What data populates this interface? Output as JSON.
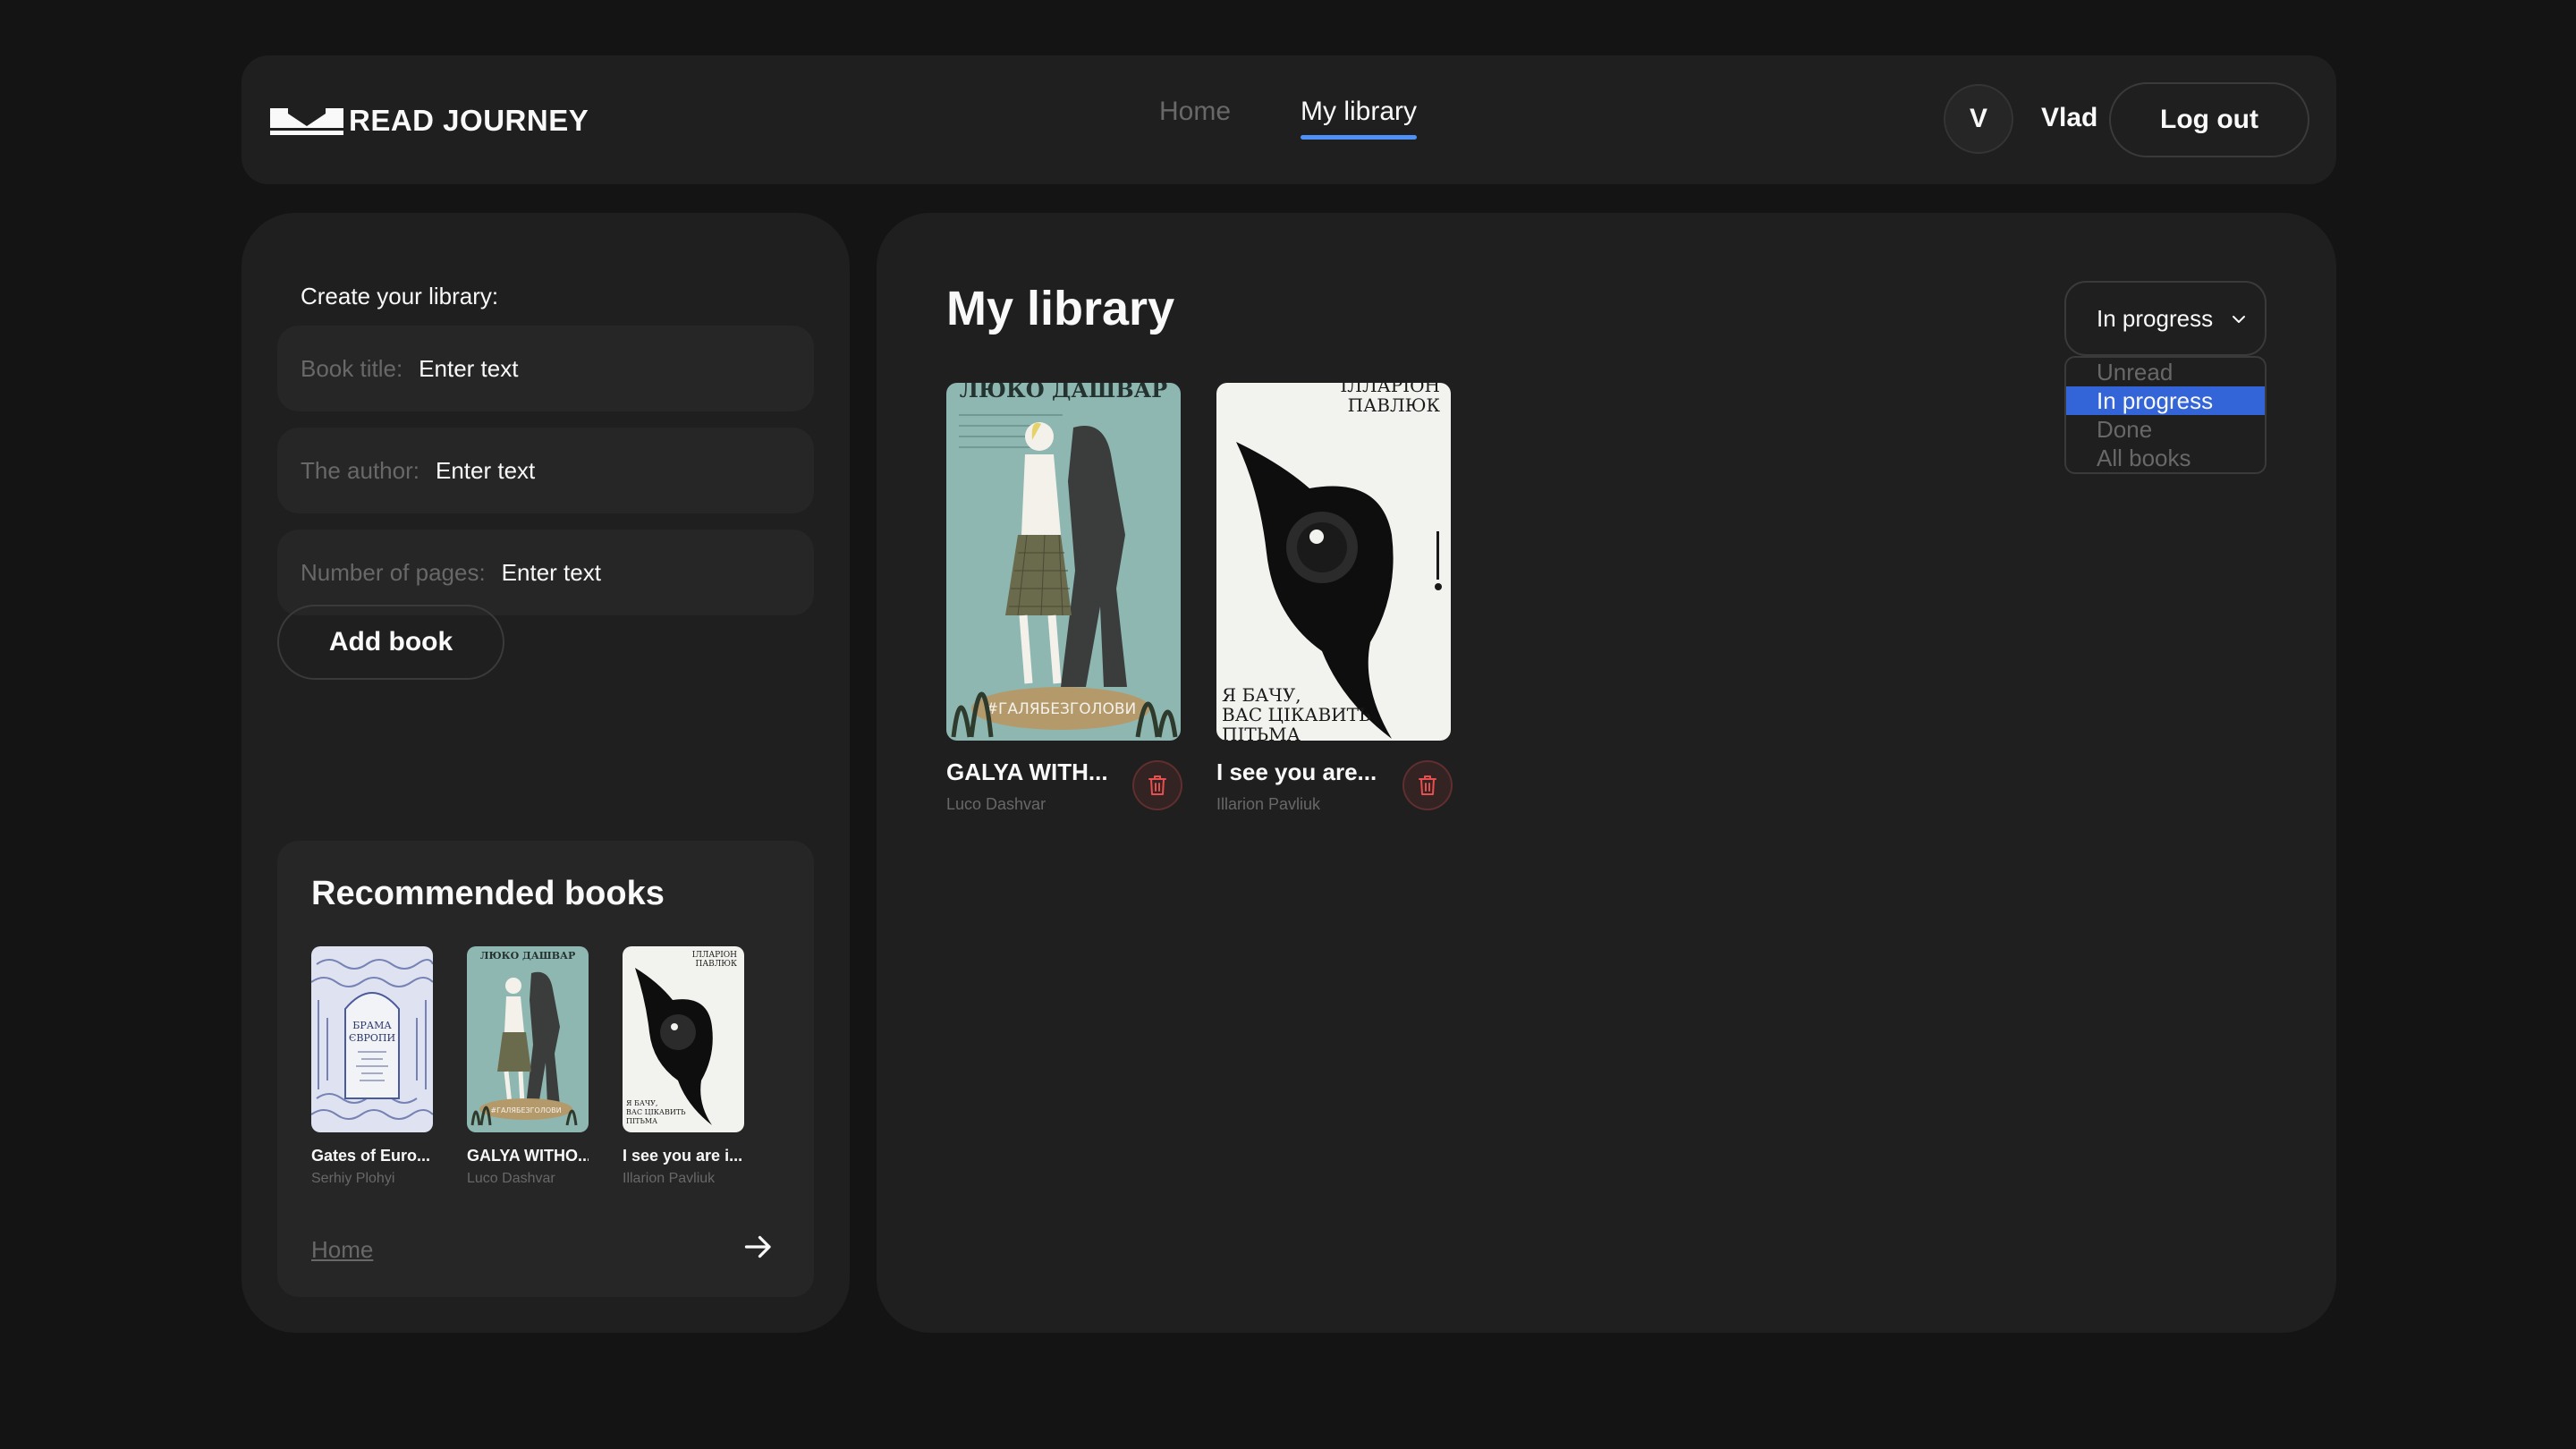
{
  "header": {
    "logo_text": "READ JOURNEY",
    "nav": [
      "Home",
      "My library"
    ],
    "user_initial": "V",
    "user_name": "Vlad",
    "logout_label": "Log out"
  },
  "sidebar": {
    "create_label": "Create your library:",
    "fields": [
      {
        "label": "Book title:",
        "placeholder": "Enter text"
      },
      {
        "label": "The author:",
        "placeholder": "Enter text"
      },
      {
        "label": "Number of pages:",
        "placeholder": "Enter text"
      }
    ],
    "add_button": "Add book",
    "recommended": {
      "title": "Recommended books",
      "books": [
        {
          "title": "Gates of Euro...",
          "author": "Serhiy Plohyi",
          "cover_text": [
            "БРАМА",
            "ЄВРОПИ"
          ]
        },
        {
          "title": "GALYA WITHO...",
          "author": "Luco Dashvar",
          "cover_text": [
            "ЛЮКО ДАШВАР",
            "#ГАЛЯБЕЗГОЛОВИ"
          ]
        },
        {
          "title": "I see you are i...",
          "author": "Illarion Pavliuk",
          "cover_text": [
            "ІЛЛАРІОН",
            "ПАВЛЮК",
            "Я БАЧУ,",
            "ВАС ЦІКАВИТЬ",
            "ПІТЬМА"
          ]
        }
      ],
      "home_link": "Home"
    }
  },
  "main": {
    "title": "My library",
    "filter": {
      "selected": "In progress",
      "options": [
        "Unread",
        "In progress",
        "Done",
        "All books"
      ]
    },
    "books": [
      {
        "title": "GALYA WITH...",
        "author": "Luco Dashvar",
        "cover_text": [
          "ЛЮКО ДАШВАР",
          "#ГАЛЯБЕЗГОЛОВИ"
        ]
      },
      {
        "title": "I see you are...",
        "author": "Illarion Pavliuk",
        "cover_text": [
          "ІЛЛАРІОН",
          "ПАВЛЮК",
          "Я БАЧУ,",
          "ВАС ЦІКАВИТЬ",
          "ПІТЬМА"
        ]
      }
    ]
  },
  "colors": {
    "background": "#141414",
    "panel": "#1f1f1f",
    "input": "#262626",
    "accent": "#4f92f7",
    "dropdown_selected": "#3465d8",
    "trash": "#e85050",
    "muted_text": "#686868"
  },
  "icons": [
    "book-logo-icon",
    "chevron-down-icon",
    "trash-icon",
    "arrow-right-icon"
  ]
}
